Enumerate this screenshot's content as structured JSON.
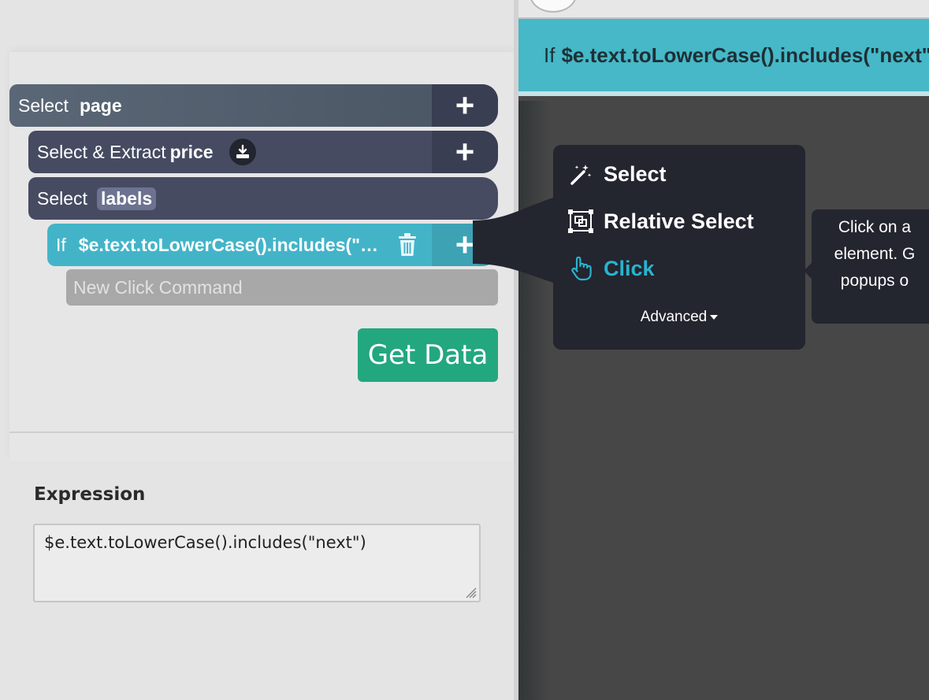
{
  "commands": {
    "page": {
      "label": "Select",
      "name": "page",
      "add": "+"
    },
    "price": {
      "label": "Select & Extract",
      "name": "price",
      "add": "+"
    },
    "labels": {
      "label": "Select",
      "name": "labels"
    },
    "condition": {
      "label": "If",
      "expr": "$e.text.toLowerCase().includes(\"next\")",
      "add": "+"
    },
    "new_click": {
      "placeholder": "New Click Command"
    }
  },
  "get_data_label": "Get Data",
  "expression": {
    "label": "Expression",
    "value": "$e.text.toLowerCase().includes(\"next\")"
  },
  "banner": {
    "prefix": "If",
    "expr": "$e.text.toLowerCase().includes(\"next\")"
  },
  "menu": {
    "items": [
      {
        "label": "Select",
        "icon": "magic-wand-icon"
      },
      {
        "label": "Relative Select",
        "icon": "relative-select-icon"
      },
      {
        "label": "Click",
        "icon": "pointer-hand-icon"
      }
    ],
    "advanced": "Advanced"
  },
  "tooltip": {
    "lines": [
      "Click on a",
      "element. G",
      "popups o"
    ]
  },
  "colors": {
    "accent": "#43b4c8",
    "get_data": "#23a77e",
    "menu_bg": "#23252f",
    "click_active": "#27b4cf"
  }
}
